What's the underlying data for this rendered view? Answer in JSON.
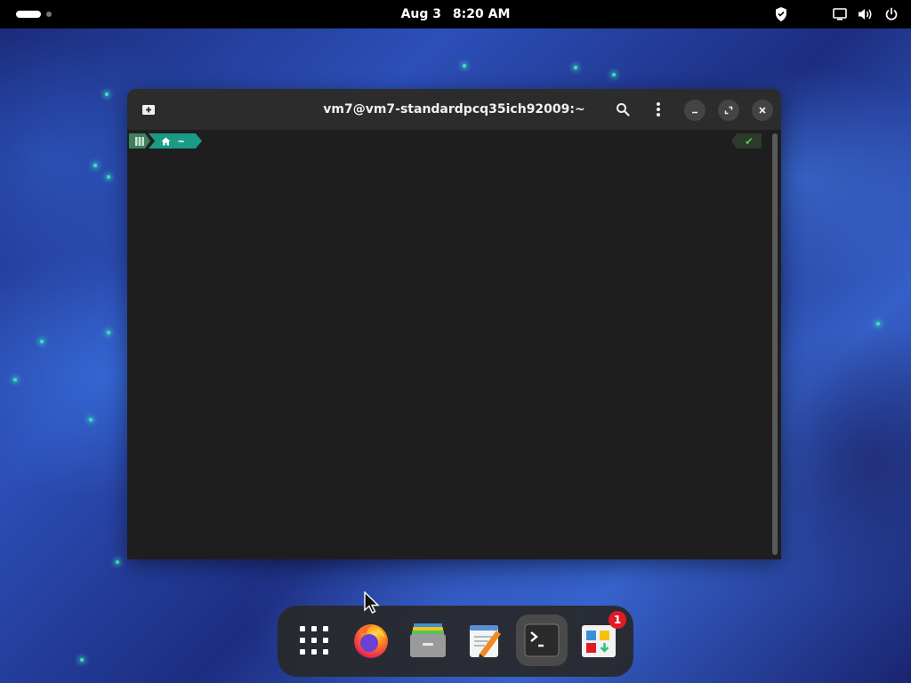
{
  "topbar": {
    "date": "Aug 3",
    "time": "8:20 AM",
    "icons": [
      "shield-icon",
      "display-icon",
      "volume-icon",
      "power-icon"
    ]
  },
  "terminal": {
    "title": "vm7@vm7-standardpcq35ich92009:~",
    "prompt": {
      "dir_icon": "home-icon",
      "dir": "~"
    },
    "status": "✔"
  },
  "dock": {
    "items": [
      "show-apps",
      "firefox",
      "files",
      "text-editor",
      "terminal",
      "software"
    ],
    "software_badge": "1"
  },
  "colors": {
    "accent_teal": "#1a9b86",
    "badge_red": "#e01b24"
  }
}
